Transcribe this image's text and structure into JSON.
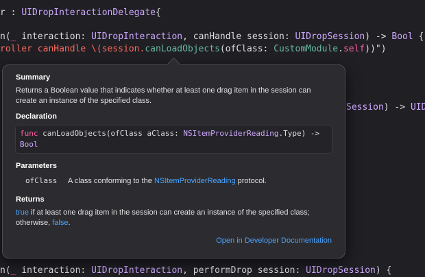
{
  "editor": {
    "line1": {
      "p1": "r : ",
      "p2": "UIDropInteractionDelegate",
      "p3": "{"
    },
    "line2": {
      "p1": "n(",
      "p2": "_",
      "p3": " interaction: ",
      "p4": "UIDropInteraction",
      "p5": ", canHandle session: ",
      "p6": "UIDropSession",
      "p7": ") -> ",
      "p8": "Bool",
      "p9": " {"
    },
    "line3": {
      "p1": "roller canHandle \\(session.",
      "p2": "canLoadObjects",
      "p3": "(ofClass: ",
      "p4": "CustomModule",
      "p5": ".",
      "p6": "self",
      "p7": "))\")"
    },
    "line_right": {
      "p1": "Session",
      "p2": ") -> ",
      "p3": "UIDr"
    },
    "line_bottom": {
      "p1": "n(",
      "p2": "_",
      "p3": " interaction: ",
      "p4": "UIDropInteraction",
      "p5": ", performDrop session: ",
      "p6": "UIDropSession",
      "p7": ") {"
    }
  },
  "popover": {
    "summary_title": "Summary",
    "summary_text": "Returns a Boolean value that indicates whether at least one drag item in the session can create an instance of the specified class.",
    "declaration_title": "Declaration",
    "declaration": {
      "kw": "func",
      "name": " canLoadObjects(ofClass aClass: ",
      "type1": "NSItemProviderReading",
      "rest": ".Type) -> ",
      "type2": "Bool"
    },
    "parameters_title": "Parameters",
    "param_name": "ofClass",
    "param_desc_prefix": "A class conforming to the ",
    "param_desc_link": "NSItemProviderReading",
    "param_desc_suffix": " protocol.",
    "returns_title": "Returns",
    "returns": {
      "link1": "true",
      "text1": " if at least one drag item in the session can create an instance of the specified class; otherwise, ",
      "link2": "false",
      "text2": "."
    },
    "open_doc_link": "Open in Developer Documentation"
  },
  "colors": {
    "background": "#1f1f24",
    "keyword": "#fc5fa3",
    "type": "#d0a8ff",
    "string": "#fc6a5d",
    "link": "#4aa3ff"
  }
}
